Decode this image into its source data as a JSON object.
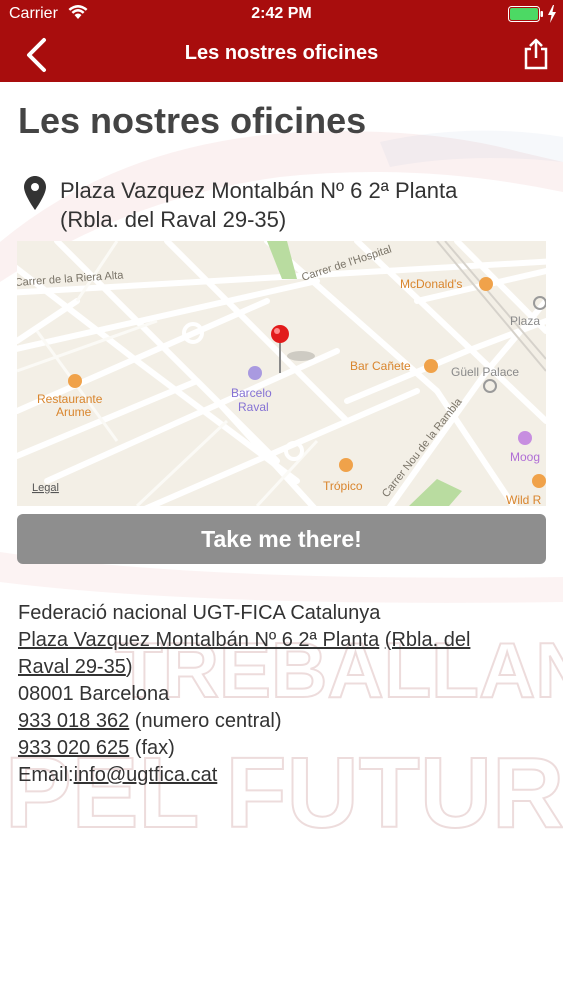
{
  "status_bar": {
    "carrier": "Carrier",
    "time": "2:42 PM",
    "battery_color": "#4cd964"
  },
  "nav": {
    "title": "Les nostres oficines",
    "back_icon": "chevron-left-icon",
    "share_icon": "share-icon",
    "bar_color": "#a80d0d"
  },
  "page": {
    "title": "Les nostres oficines",
    "address_line1": "Plaza Vazquez Montalbán Nº 6 2ª Planta",
    "address_line2": "(Rbla. del Raval 29-35)"
  },
  "map": {
    "streets": [
      "Carrer de la Riera Alta",
      "Carrer de l'Hospital",
      "Carrer Nou de la Rambla"
    ],
    "places": [
      "McDonald's",
      "Plaza",
      "Bar Cañete",
      "Güell Palace",
      "Restaurante",
      "Arume",
      "Barcelo",
      "Raval",
      "Moog",
      "Trópico",
      "Wild R"
    ],
    "legal": "Legal"
  },
  "take_button": {
    "label": "Take me there!"
  },
  "contact": {
    "org": "Federació nacional UGT-FICA Catalunya",
    "address_link1": "Plaza Vazquez Montalbán Nº 6 2ª Planta",
    "address_link2a": "(Rbla. del",
    "address_link2b": "Raval 29-35",
    "address_close": ")",
    "city": "08001 Barcelona",
    "phone1": "933 018 362",
    "phone1_note": " (numero central)",
    "phone2": "933 020 625",
    "phone2_note": " (fax)",
    "email_label": "Email:",
    "email": "info@ugtfica.cat"
  },
  "watermark": {
    "line1": "TREBALLANT",
    "line2": "PEL FUTUR"
  }
}
